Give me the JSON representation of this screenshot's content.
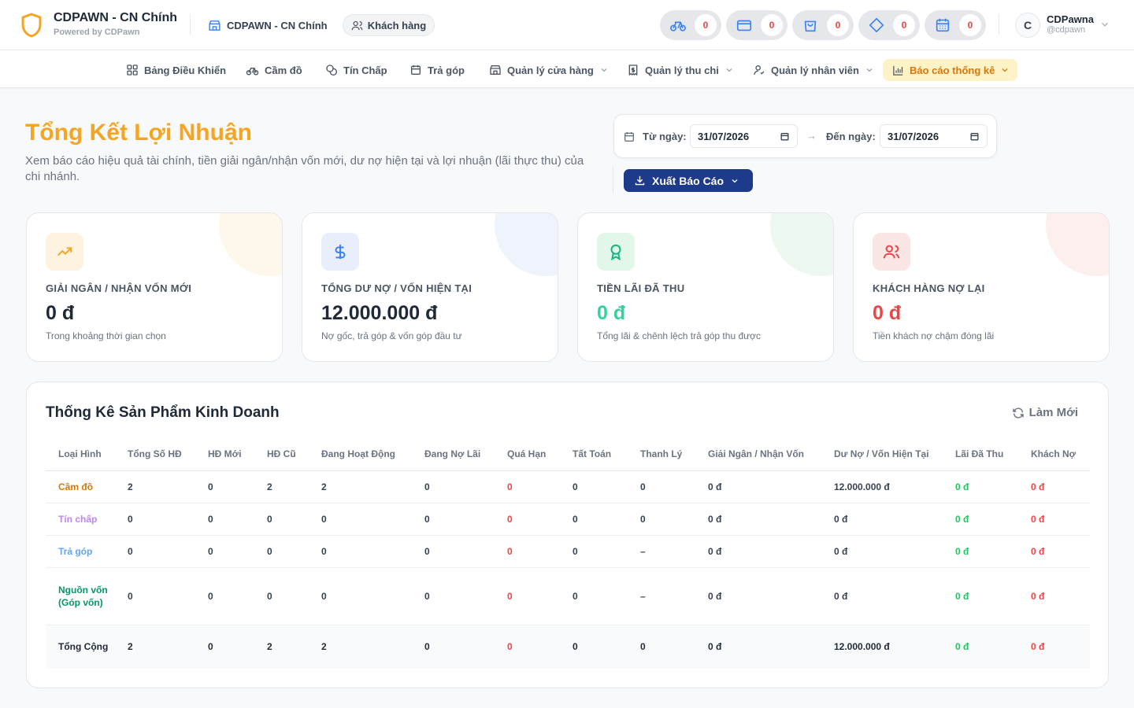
{
  "header": {
    "brand_title": "CDPAWN - CN Chính",
    "brand_sub": "Powered by CDPawn",
    "branch_label": "CDPAWN - CN Chính",
    "customer_label": "Khách hàng",
    "counters": [
      {
        "icon": "bicycle-icon",
        "count": "0"
      },
      {
        "icon": "credit-card-icon",
        "count": "0"
      },
      {
        "icon": "shopping-bag-icon",
        "count": "0"
      },
      {
        "icon": "diamond-icon",
        "count": "0"
      },
      {
        "icon": "calendar-icon",
        "count": "0"
      }
    ],
    "user": {
      "initial": "C",
      "name": "CDPawna",
      "handle": "@cdpawn"
    }
  },
  "nav": {
    "items": [
      {
        "label": "Bảng Điều Khiển",
        "icon": "grid-icon"
      },
      {
        "label": "Cầm đồ",
        "icon": "bicycle-icon"
      },
      {
        "label": "Tín Chấp",
        "icon": "coins-icon"
      },
      {
        "label": "Trả góp",
        "icon": "calendar-icon"
      },
      {
        "label": "Quản lý cửa hàng",
        "icon": "store-icon"
      },
      {
        "label": "Quản lý thu chi",
        "icon": "receipt-icon"
      },
      {
        "label": "Quản lý nhân viên",
        "icon": "user-icon"
      },
      {
        "label": "Báo cáo thống kê",
        "icon": "chart-icon"
      }
    ]
  },
  "page": {
    "title": "Tổng Kết Lợi Nhuận",
    "description": "Xem báo cáo hiệu quả tài chính, tiền giải ngân/nhận vốn mới, dư nợ hiện tại và lợi nhuận (lãi thực thu) của chi nhánh.",
    "from_label": "Từ ngày:",
    "from_value": "31/07/2026",
    "to_label": "Đến ngày:",
    "to_value": "31/07/2026",
    "arrow": "→",
    "export_label": "Xuất Báo Cáo"
  },
  "cards": [
    {
      "label": "GIẢI NGÂN / NHẬN VỐN MỚI",
      "value": "0 đ",
      "note": "Trong khoảng thời gian chọn",
      "accent": "#f5a524"
    },
    {
      "label": "TỔNG DƯ NỢ / VỐN HIỆN TẠI",
      "value": "12.000.000 đ",
      "note": "Nợ gốc, trả góp & vốn góp đầu tư",
      "accent": "#3b82f6"
    },
    {
      "label": "TIỀN LÃI ĐÃ THU",
      "value": "0 đ",
      "note": "Tổng lãi & chênh lệch trả góp thu được",
      "accent": "#34d399"
    },
    {
      "label": "KHÁCH HÀNG NỢ LẠI",
      "value": "0 đ",
      "note": "Tiền khách nợ chậm đóng lãi",
      "accent": "#ef4444"
    }
  ],
  "table": {
    "title": "Thống Kê Sản Phẩm Kinh Doanh",
    "refresh_label": "Làm Mới",
    "columns": [
      "Loại Hình",
      "Tổng Số HĐ",
      "HĐ Mới",
      "HĐ Cũ",
      "Đang Hoạt Động",
      "Đang Nợ Lãi",
      "Quá Hạn",
      "Tất Toán",
      "Thanh Lý",
      "Giải Ngân / Nhận Vốn",
      "Dư Nợ / Vốn Hiện Tại",
      "Lãi Đã Thu",
      "Khách Nợ"
    ],
    "rows": [
      [
        "Cầm đồ",
        "2",
        "0",
        "2",
        "2",
        "0",
        "0",
        "0",
        "0",
        "0 đ",
        "12.000.000 đ",
        "0 đ",
        "0 đ"
      ],
      [
        "Tín chấp",
        "0",
        "0",
        "0",
        "0",
        "0",
        "0",
        "0",
        "0",
        "0 đ",
        "0 đ",
        "0 đ",
        "0 đ"
      ],
      [
        "Trả góp",
        "0",
        "0",
        "0",
        "0",
        "0",
        "0",
        "0",
        "–",
        "0 đ",
        "0 đ",
        "0 đ",
        "0 đ"
      ],
      [
        "Nguồn vốn (Góp vốn)",
        "0",
        "0",
        "0",
        "0",
        "0",
        "0",
        "0",
        "–",
        "0 đ",
        "0 đ",
        "0 đ",
        "0 đ"
      ],
      [
        "Tổng Cộng",
        "2",
        "0",
        "2",
        "2",
        "0",
        "0",
        "0",
        "0",
        "0 đ",
        "12.000.000 đ",
        "0 đ",
        "0 đ"
      ]
    ]
  }
}
